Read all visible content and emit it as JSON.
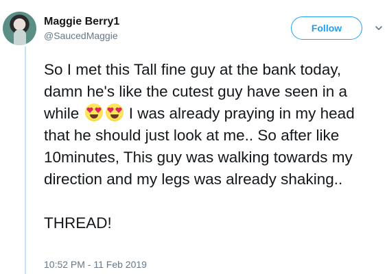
{
  "user": {
    "display_name": "Maggie Berry1",
    "handle": "@SaucedMaggie"
  },
  "actions": {
    "follow_label": "Follow"
  },
  "tweet": {
    "part1": "So I met this Tall fine guy at the bank today, damn he's like the cutest guy have seen in a while ",
    "emoji": [
      "heart-eyes-emoji",
      "heart-eyes-emoji"
    ],
    "part2": " I was already praying in my head that he should just look at me.. So after like 10minutes, This guy was walking towards my direction and my legs was already shaking..",
    "part3": "THREAD!",
    "timestamp": "10:52 PM - 11 Feb 2019"
  },
  "colors": {
    "accent": "#1da1f2",
    "secondary_text": "#657786",
    "thread_line": "#c4e1f6"
  }
}
